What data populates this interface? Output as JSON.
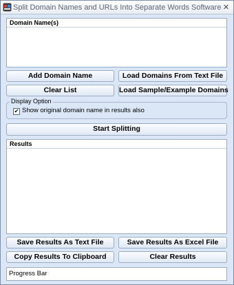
{
  "window": {
    "title": "Split Domain Names and URLs Into Separate Words Software",
    "close_glyph": "✕"
  },
  "domains_panel": {
    "header": "Domain Name(s)"
  },
  "buttons": {
    "add_domain": "Add Domain Name",
    "load_from_file": "Load Domains From Text File",
    "clear_list": "Clear List",
    "load_sample": "Load Sample/Example Domains",
    "start_splitting": "Start Splitting",
    "save_text": "Save Results As Text File",
    "save_excel": "Save Results As Excel File",
    "copy_clipboard": "Copy Results To Clipboard",
    "clear_results": "Clear Results"
  },
  "display_option": {
    "legend": "Display Option",
    "show_original_label": "Show original domain name in results also",
    "show_original_checked": true,
    "check_glyph": "✔"
  },
  "results_panel": {
    "header": "Results"
  },
  "progress": {
    "label": "Progress Bar"
  }
}
